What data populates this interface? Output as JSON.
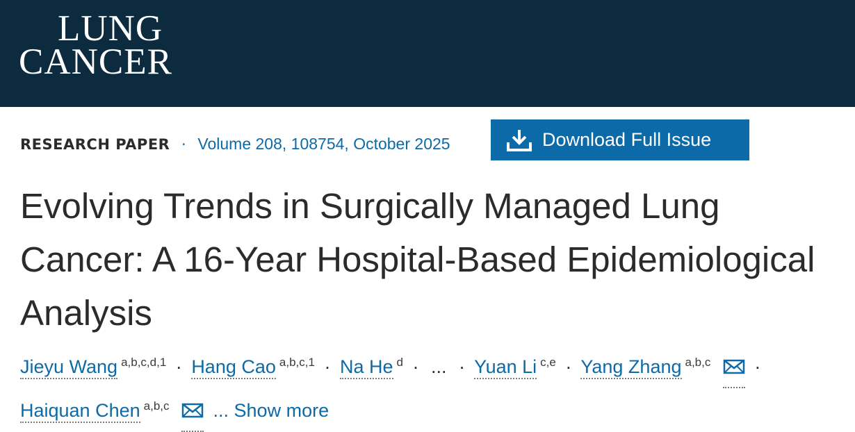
{
  "journal": {
    "logo_line1": "LUNG",
    "logo_line2": "CANCER"
  },
  "meta": {
    "article_type": "RESEARCH PAPER",
    "separator": "·",
    "volume": "Volume 208, 108754, October 2025"
  },
  "download_button": {
    "label": "Download Full Issue",
    "icon": "download-icon"
  },
  "title": "Evolving Trends in Surgically Managed Lung Cancer: A 16-Year Hospital-Based Epidemiological Analysis",
  "authors": [
    {
      "name": "Jieyu Wang",
      "affiliations": "a,b,c,d,1"
    },
    {
      "name": "Hang Cao",
      "affiliations": "a,b,c,1"
    },
    {
      "name": "Na He",
      "affiliations": "d"
    },
    {
      "name": "Yuan Li",
      "affiliations": "c,e"
    },
    {
      "name": "Yang Zhang",
      "affiliations": "a,b,c"
    },
    {
      "name": "Haiquan Chen",
      "affiliations": "a,b,c"
    }
  ],
  "author_separator": "·",
  "ellipsis": "...",
  "show_more": "... Show more",
  "colors": {
    "banner": "#0c2b3f",
    "link": "#0c6aa8",
    "button": "#0c6aa8",
    "text": "#2b2b2b"
  }
}
